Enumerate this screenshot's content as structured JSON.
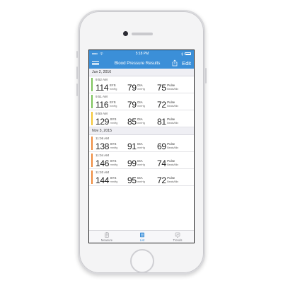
{
  "status_bar": {
    "time": "5:18 PM"
  },
  "nav": {
    "title": "Blood Pressure Results",
    "edit_label": "Edit"
  },
  "labels": {
    "sys": "SYS",
    "dia": "DIA",
    "pulse": "Pulse",
    "bp_unit": "mmHg",
    "pulse_unit": "Beats/Min"
  },
  "sections": [
    {
      "date": "Jun 2, 2016",
      "readings": [
        {
          "time": "9:52 AM",
          "sys": "114",
          "dia": "79",
          "pulse": "75",
          "color": "#7cc35a"
        },
        {
          "time": "9:51 AM",
          "sys": "116",
          "dia": "79",
          "pulse": "72",
          "color": "#7cc35a"
        },
        {
          "time": "9:50 AM",
          "sys": "129",
          "dia": "85",
          "pulse": "81",
          "color": "#f3c534"
        }
      ]
    },
    {
      "date": "Nov 3, 2015",
      "readings": [
        {
          "time": "11:06 AM",
          "sys": "138",
          "dia": "91",
          "pulse": "69",
          "color": "#ee8a3c"
        },
        {
          "time": "11:04 AM",
          "sys": "146",
          "dia": "99",
          "pulse": "74",
          "color": "#ee8a3c"
        },
        {
          "time": "11:30 AM",
          "sys": "144",
          "dia": "95",
          "pulse": "72",
          "color": "#ee8a3c"
        }
      ]
    }
  ],
  "tabs": [
    {
      "label": "Measure",
      "icon": "clipboard-icon"
    },
    {
      "label": "List",
      "icon": "list-icon"
    },
    {
      "label": "Trends",
      "icon": "chart-icon"
    }
  ],
  "colors": {
    "accent": "#3b8fd8",
    "normal": "#7cc35a",
    "elevated": "#f3c534",
    "high": "#ee8a3c"
  }
}
